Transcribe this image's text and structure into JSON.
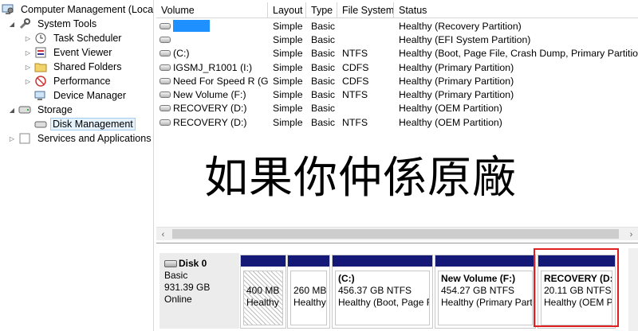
{
  "tree": {
    "root": "Computer Management (Local",
    "items": [
      {
        "label": "System Tools",
        "level": 1,
        "expander": "◢"
      },
      {
        "label": "Task Scheduler",
        "level": 2,
        "expander": "▷"
      },
      {
        "label": "Event Viewer",
        "level": 2,
        "expander": "▷"
      },
      {
        "label": "Shared Folders",
        "level": 2,
        "expander": "▷"
      },
      {
        "label": "Performance",
        "level": 2,
        "expander": "▷"
      },
      {
        "label": "Device Manager",
        "level": 2,
        "expander": ""
      },
      {
        "label": "Storage",
        "level": 1,
        "expander": "◢"
      },
      {
        "label": "Disk Management",
        "level": 2,
        "expander": ""
      },
      {
        "label": "Services and Applications",
        "level": 1,
        "expander": "▷"
      }
    ]
  },
  "columns": [
    "Volume",
    "Layout",
    "Type",
    "File System",
    "Status"
  ],
  "volumes": [
    {
      "volume": "",
      "layout": "Simple",
      "type": "Basic",
      "fs": "",
      "status": "Healthy (Recovery Partition)"
    },
    {
      "volume": "",
      "layout": "Simple",
      "type": "Basic",
      "fs": "",
      "status": "Healthy (EFI System Partition)"
    },
    {
      "volume": "(C:)",
      "layout": "Simple",
      "type": "Basic",
      "fs": "NTFS",
      "status": "Healthy (Boot, Page File, Crash Dump, Primary Partitio"
    },
    {
      "volume": "IGSMJ_R1001 (I:)",
      "layout": "Simple",
      "type": "Basic",
      "fs": "CDFS",
      "status": "Healthy (Primary Partition)"
    },
    {
      "volume": "Need For Speed R (G:)",
      "layout": "Simple",
      "type": "Basic",
      "fs": "CDFS",
      "status": "Healthy (Primary Partition)"
    },
    {
      "volume": "New Volume (F:)",
      "layout": "Simple",
      "type": "Basic",
      "fs": "NTFS",
      "status": "Healthy (Primary Partition)"
    },
    {
      "volume": "RECOVERY (D:)",
      "layout": "Simple",
      "type": "Basic",
      "fs": "",
      "status": "Healthy (OEM Partition)"
    },
    {
      "volume": "RECOVERY (D:)",
      "layout": "Simple",
      "type": "Basic",
      "fs": "NTFS",
      "status": "Healthy (OEM Partition)"
    }
  ],
  "overlay_text": "如果你仲係原廠",
  "scroll": {
    "left": "‹",
    "right": "›"
  },
  "disk": {
    "name": "Disk 0",
    "type": "Basic",
    "size": "931.39 GB",
    "status": "Online"
  },
  "partitions": [
    {
      "name": "",
      "size": "400 MB",
      "status": "Healthy",
      "hatched": true
    },
    {
      "name": "",
      "size": "260 MB",
      "status": "Healthy",
      "hatched": false
    },
    {
      "name": "(C:)",
      "size": "456.37 GB NTFS",
      "status": "Healthy (Boot, Page F",
      "hatched": false
    },
    {
      "name": "New Volume  (F:)",
      "size": "454.27 GB NTFS",
      "status": "Healthy (Primary Part",
      "hatched": false
    },
    {
      "name": "RECOVERY  (D:)",
      "size": "20.11 GB NTFS",
      "status": "Healthy (OEM P",
      "hatched": false
    }
  ],
  "colors": {
    "partition_bar": "#141877",
    "highlight": "#e02020",
    "redacted": "#1e90ff"
  }
}
